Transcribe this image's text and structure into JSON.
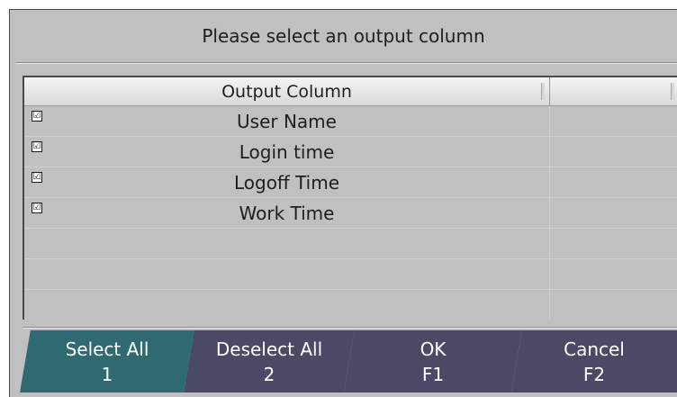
{
  "dialog": {
    "title": "Please select an output column"
  },
  "grid": {
    "headers": [
      "Output Column",
      ""
    ],
    "rows": [
      {
        "checked": true,
        "label": "User Name"
      },
      {
        "checked": true,
        "label": "Login time"
      },
      {
        "checked": true,
        "label": "Logoff Time"
      },
      {
        "checked": true,
        "label": "Work Time"
      },
      {
        "checked": false,
        "label": ""
      },
      {
        "checked": false,
        "label": ""
      },
      {
        "checked": false,
        "label": ""
      }
    ],
    "check_glyph": "☑"
  },
  "buttons": [
    {
      "label": "Select All",
      "key": "1",
      "active": true
    },
    {
      "label": "Deselect All",
      "key": "2",
      "active": false
    },
    {
      "label": "OK",
      "key": "F1",
      "active": false
    },
    {
      "label": "Cancel",
      "key": "F2",
      "active": false
    }
  ],
  "colors": {
    "dialog_bg": "#c0c0c0",
    "button_bg": "#4b4a66",
    "button_active_bg": "#2f6a72",
    "text": "#1e1e1e",
    "button_text": "#ffffff"
  }
}
